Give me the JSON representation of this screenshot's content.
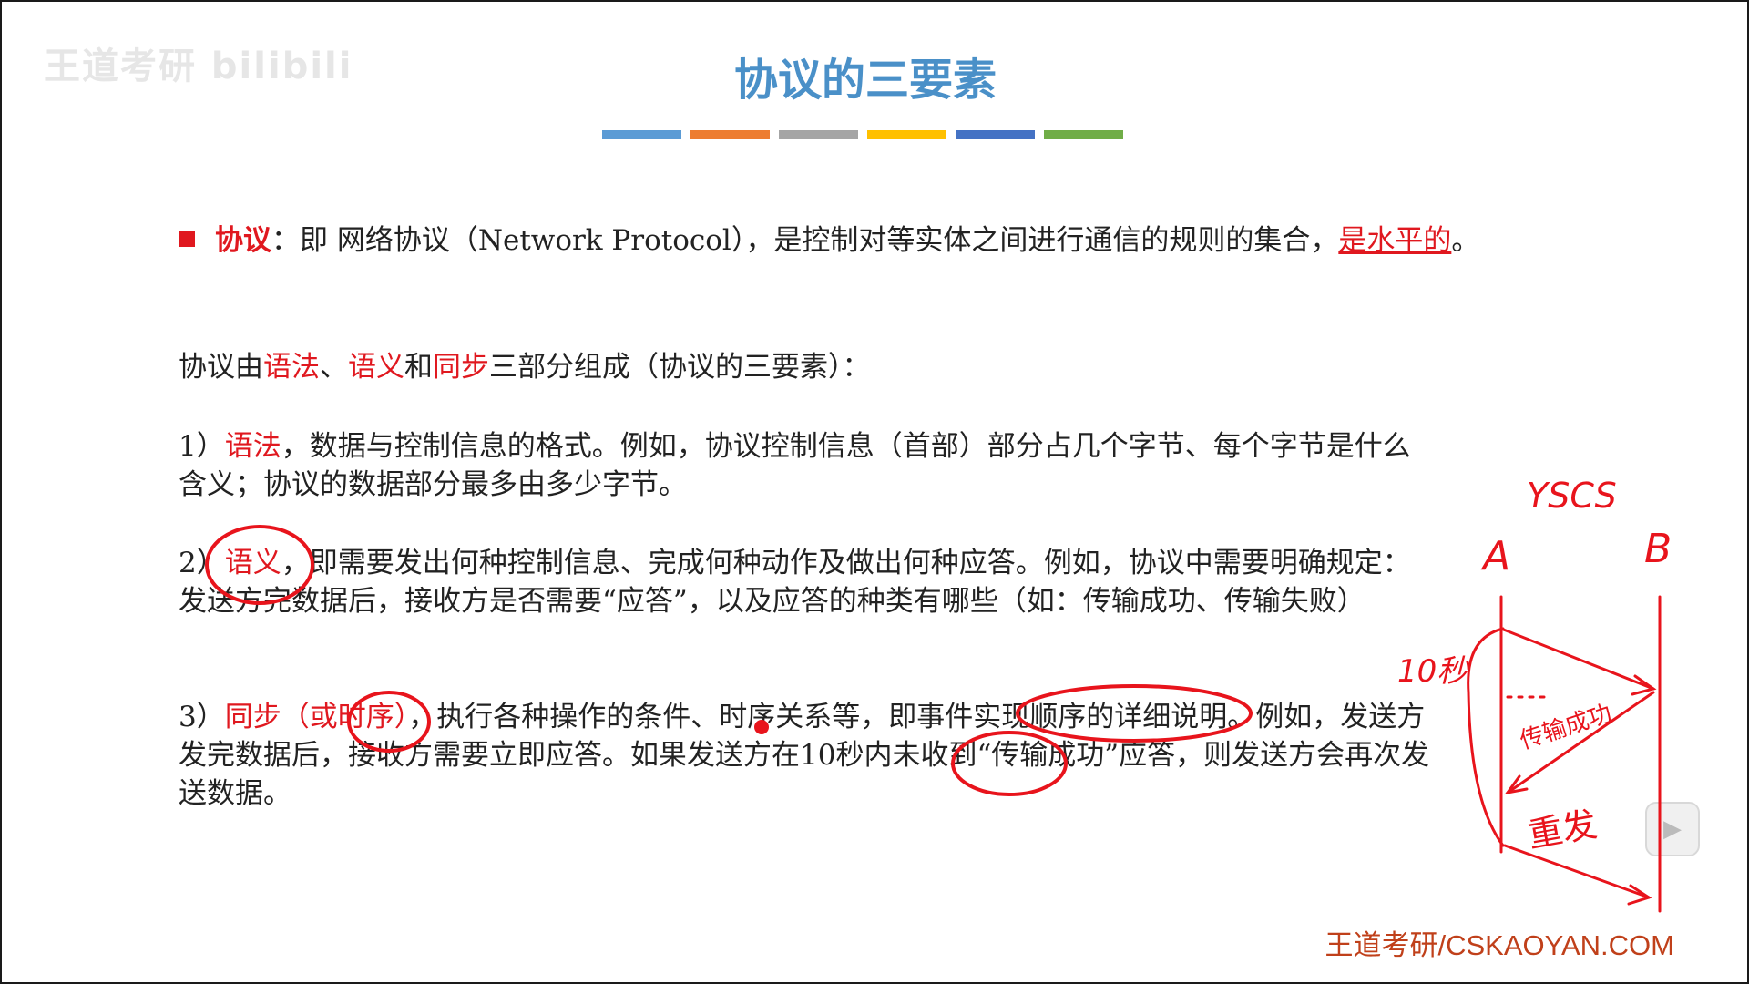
{
  "watermark": "王道考研 bilibili",
  "slide_title": "协议的三要素",
  "color_bar": [
    "#5b9bd5",
    "#ed7d31",
    "#a5a5a5",
    "#ffc000",
    "#4472c4",
    "#70ad47"
  ],
  "definition": {
    "term": "协议",
    "colon": "：",
    "text": "即 网络协议（Network Protocol），是控制对等实体之间进行通信的规则的集合，",
    "highlight": "是水平的",
    "end": "。"
  },
  "intro": {
    "pre": "协议由",
    "syntax": "语法",
    "sep1": "、",
    "semantics": "语义",
    "and": "和",
    "sync": "同步",
    "post": "三部分组成（协议的三要素）："
  },
  "item1": {
    "num": "1）",
    "term": "语法",
    "text": "，数据与控制信息的格式。例如，协议控制信息（首部）部分占几个字节、每个字节是什么含义；协议的数据部分最多由多少字节。"
  },
  "item2": {
    "num": "2）",
    "term": "语义",
    "text": "，即需要发出何种控制信息、完成何种动作及做出何种应答。例如，协议中需要明确规定：发送方完数据后，接收方是否需要“应答”，以及应答的种类有哪些（如：传输成功、传输失败）"
  },
  "item3": {
    "num": "3）",
    "term": "同步",
    "paren": "（或时序）",
    "text": "，执行各种操作的条件、时序关系等，即事件实现顺序的详细说明。例如，发送方发完数据后，接收方需要立即应答。如果发送方在10秒内未收到“传输成功”应答，则发送方会再次发送数据。"
  },
  "logo": "王道考研/CSKAOYAN.COM",
  "annotations": {
    "yscs": "YSCS",
    "a": "A",
    "b": "B",
    "timeout": "10秒",
    "success": "传输成功",
    "resend": "重发"
  },
  "play_icon": "play-icon"
}
